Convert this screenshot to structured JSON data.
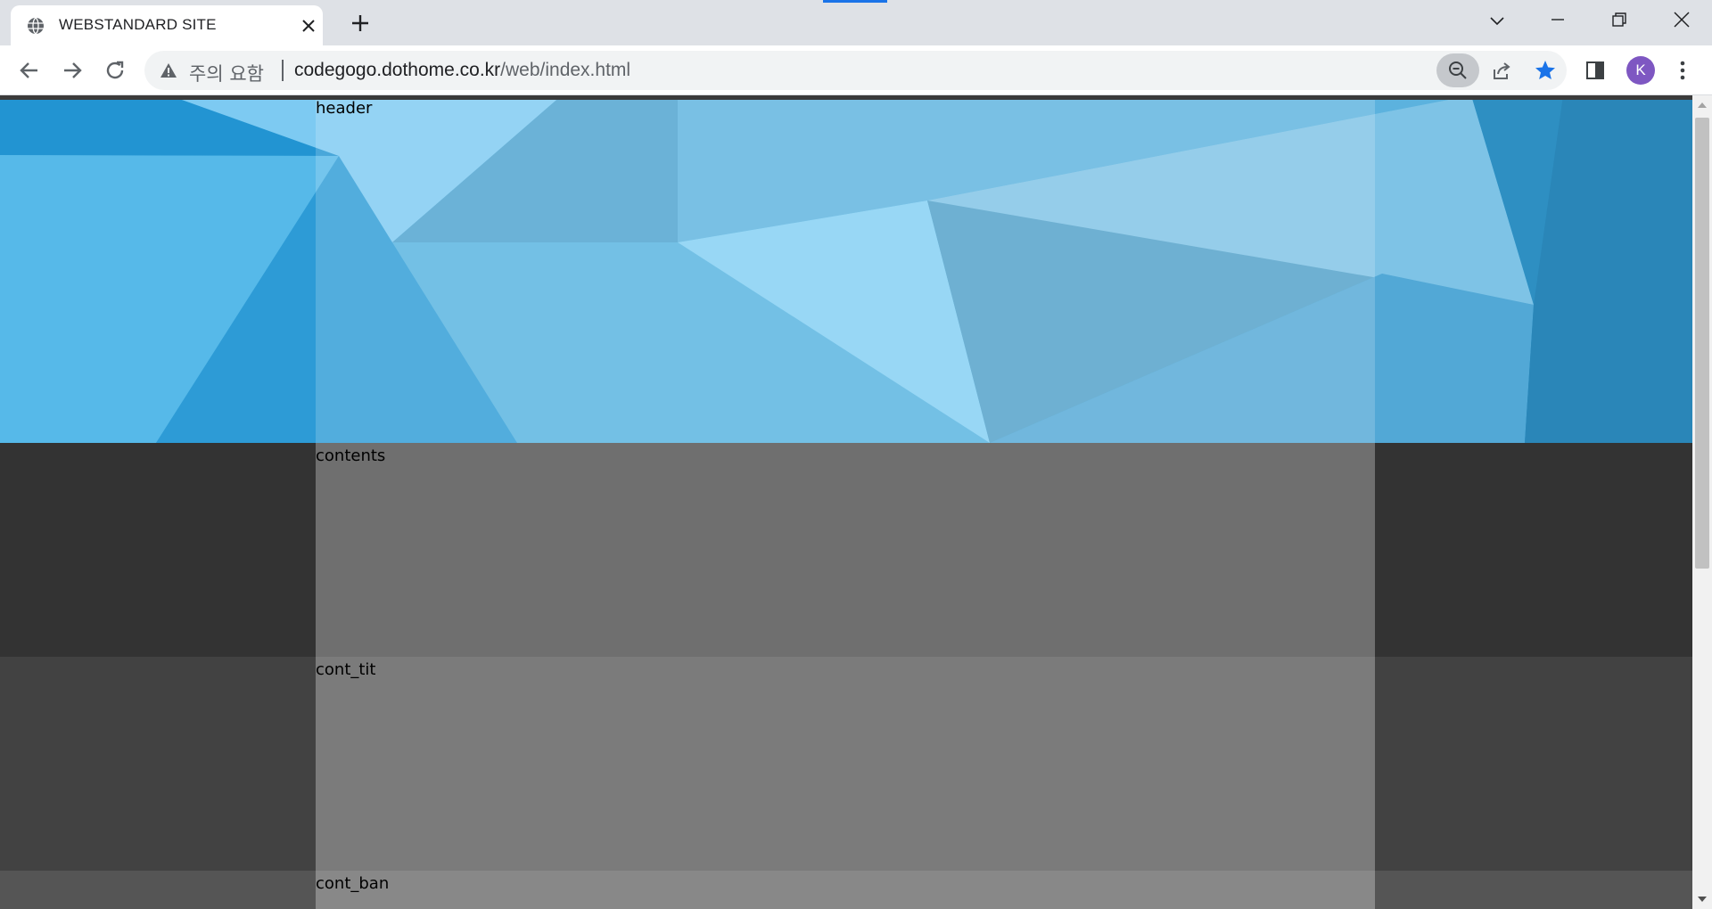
{
  "browser": {
    "tab_title": "WEBSTANDARD SITE",
    "security_label": "주의 요함",
    "url_host": "codegogo.dothome.co.kr",
    "url_path": "/web/index.html",
    "avatar_letter": "K",
    "accent_color": "#1a73e8",
    "icons": [
      "globe-icon",
      "close-icon",
      "plus-icon",
      "chevron-down-icon",
      "minimize-icon",
      "restore-icon",
      "back-arrow-icon",
      "forward-arrow-icon",
      "reload-icon",
      "warning-icon",
      "zoom-out-icon",
      "share-icon",
      "star-icon",
      "side-panel-icon",
      "more-vert-icon"
    ]
  },
  "page": {
    "header_label": "header",
    "contents_label": "contents",
    "cont_tit_label": "cont_tit",
    "cont_ban_label": "cont_ban"
  }
}
